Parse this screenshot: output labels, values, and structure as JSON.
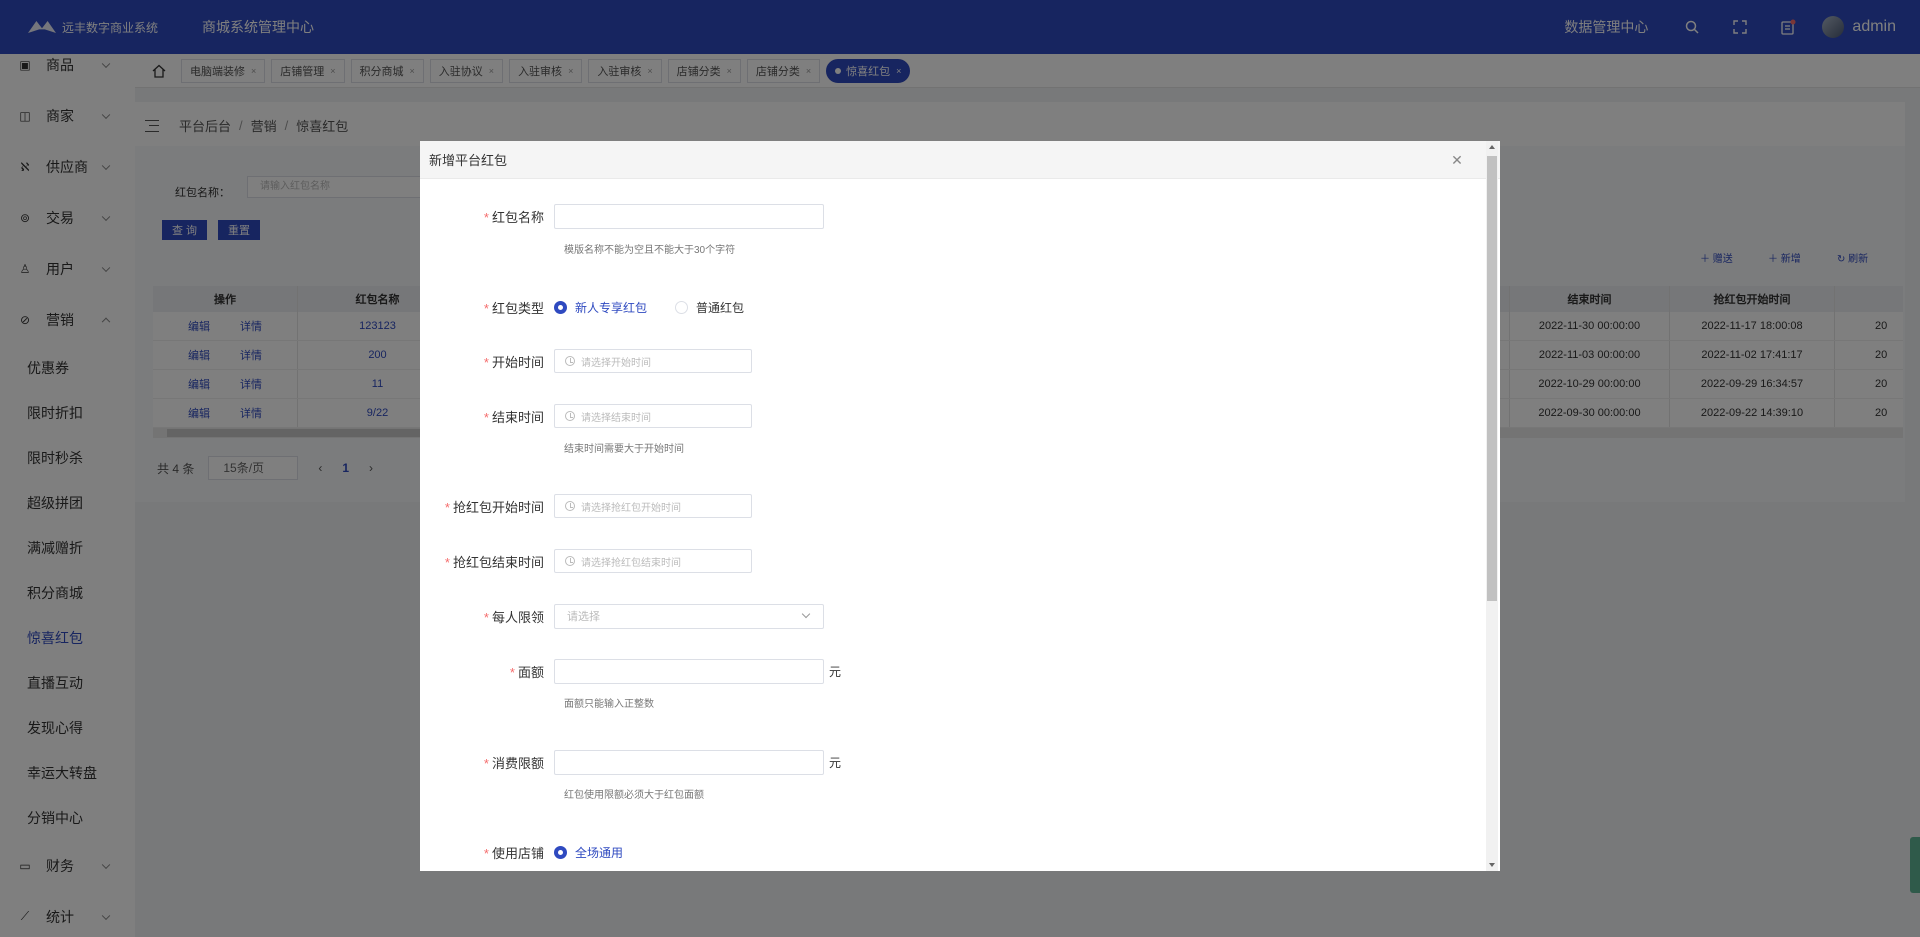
{
  "header": {
    "logo_text": "远丰数字商业系统",
    "system_title": "商城系统管理中心",
    "data_center": "数据管理中心",
    "username": "admin"
  },
  "sidebar": {
    "groups_top": [
      {
        "label": "商品",
        "icon": "box-icon"
      },
      {
        "label": "商家",
        "icon": "store-icon"
      },
      {
        "label": "供应商",
        "icon": "supplier-icon"
      },
      {
        "label": "交易",
        "icon": "trade-icon"
      },
      {
        "label": "用户",
        "icon": "user-icon"
      },
      {
        "label": "营销",
        "icon": "tag-icon"
      }
    ],
    "marketing_items": [
      "优惠券",
      "限时折扣",
      "限时秒杀",
      "超级拼团",
      "满减赠折",
      "积分商城",
      "惊喜红包",
      "直播互动",
      "发现心得",
      "幸运大转盘",
      "分销中心"
    ],
    "groups_bottom": [
      {
        "label": "财务",
        "icon": "wallet-icon"
      },
      {
        "label": "统计",
        "icon": "chart-icon"
      }
    ]
  },
  "tabs": [
    "电脑端装修",
    "店铺管理",
    "积分商城",
    "入驻协议",
    "入驻审核",
    "入驻审核",
    "店铺分类",
    "店铺分类",
    "惊喜红包"
  ],
  "breadcrumb": [
    "平台后台",
    "营销",
    "惊喜红包"
  ],
  "filter": {
    "label": "红包名称：",
    "placeholder": "请输入红包名称",
    "query": "查 询",
    "reset": "重置"
  },
  "toolbar": {
    "send": "赠送",
    "add": "新增",
    "refresh": "刷新"
  },
  "table": {
    "headers": {
      "op": "操作",
      "name": "红包名称",
      "end": "结束时间",
      "grab_start": "抢红包开始时间"
    },
    "edit": "编辑",
    "detail": "详情",
    "rows": [
      {
        "name": "123123",
        "end": "2022-11-30 00:00:00",
        "grab_start": "2022-11-17 18:00:08",
        "more": "20"
      },
      {
        "name": "200",
        "end": "2022-11-03 00:00:00",
        "grab_start": "2022-11-02 17:41:17",
        "more": "20"
      },
      {
        "name": "11",
        "end": "2022-10-29 00:00:00",
        "grab_start": "2022-09-29 16:34:57",
        "more": "20"
      },
      {
        "name": "9/22",
        "end": "2022-09-30 00:00:00",
        "grab_start": "2022-09-22 14:39:10",
        "more": "20"
      }
    ]
  },
  "pagination": {
    "total": "共 4 条",
    "page_size": "15条/页",
    "current": "1"
  },
  "modal": {
    "title": "新增平台红包",
    "fields": {
      "name": "红包名称",
      "name_hint": "模版名称不能为空且不能大于30个字符",
      "type": "红包类型",
      "type_opt1": "新人专享红包",
      "type_opt2": "普通红包",
      "start": "开始时间",
      "start_ph": "请选择开始时间",
      "end": "结束时间",
      "end_ph": "请选择结束时间",
      "end_hint": "结束时间需要大于开始时间",
      "grab_start": "抢红包开始时间",
      "grab_start_ph": "请选择抢红包开始时间",
      "grab_end": "抢红包结束时间",
      "grab_end_ph": "请选择抢红包结束时间",
      "limit": "每人限领",
      "limit_ph": "请选择",
      "amount": "面额",
      "amount_hint": "面额只能输入正整数",
      "spend": "消费限额",
      "spend_hint": "红包使用限额必须大于红包面额",
      "shop": "使用店铺",
      "shop_opt1": "全场通用",
      "unit": "元"
    }
  },
  "colors": {
    "primary": "#2f4ac0",
    "required": "#f56c6c"
  }
}
